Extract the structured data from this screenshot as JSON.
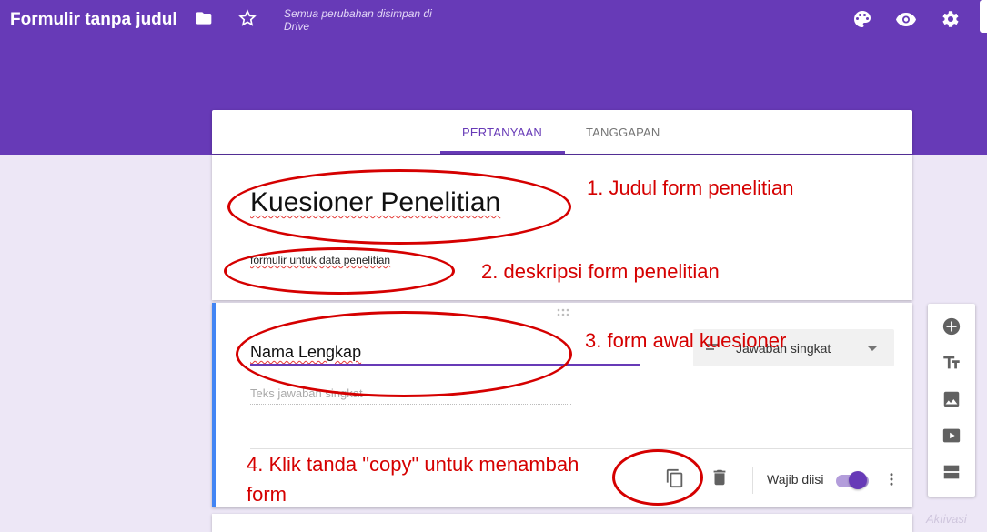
{
  "header": {
    "app_title": "Formulir tanpa judul",
    "save_status": "Semua perubahan disimpan di Drive",
    "icons": [
      "folder-icon",
      "star-icon",
      "palette-icon",
      "eye-icon",
      "gear-icon"
    ],
    "bg_color": "#673ab7"
  },
  "tabs": {
    "questions": "PERTANYAAN",
    "responses": "TANGGAPAN",
    "active": "PERTANYAAN"
  },
  "form": {
    "title": "Kuesioner Penelitian",
    "description": "formulir untuk data penelitian"
  },
  "question": {
    "title": "Nama Lengkap",
    "answer_type": "Jawaban singkat",
    "answer_placeholder": "Teks jawaban singkat",
    "required_label": "Wajib diisi",
    "required": true,
    "accent_color": "#4285f4"
  },
  "side_toolbar": {
    "icons": [
      "add-question-icon",
      "title-text-icon",
      "image-icon",
      "video-icon",
      "section-icon"
    ]
  },
  "annotations": {
    "a1": "1. Judul form penelitian",
    "a2": "2. deskripsi form penelitian",
    "a3": "3. form awal kuesioner",
    "a4_line1": "4. Klik tanda \"copy\" untuk menambah",
    "a4_line2": "form",
    "color": "#d50000"
  }
}
